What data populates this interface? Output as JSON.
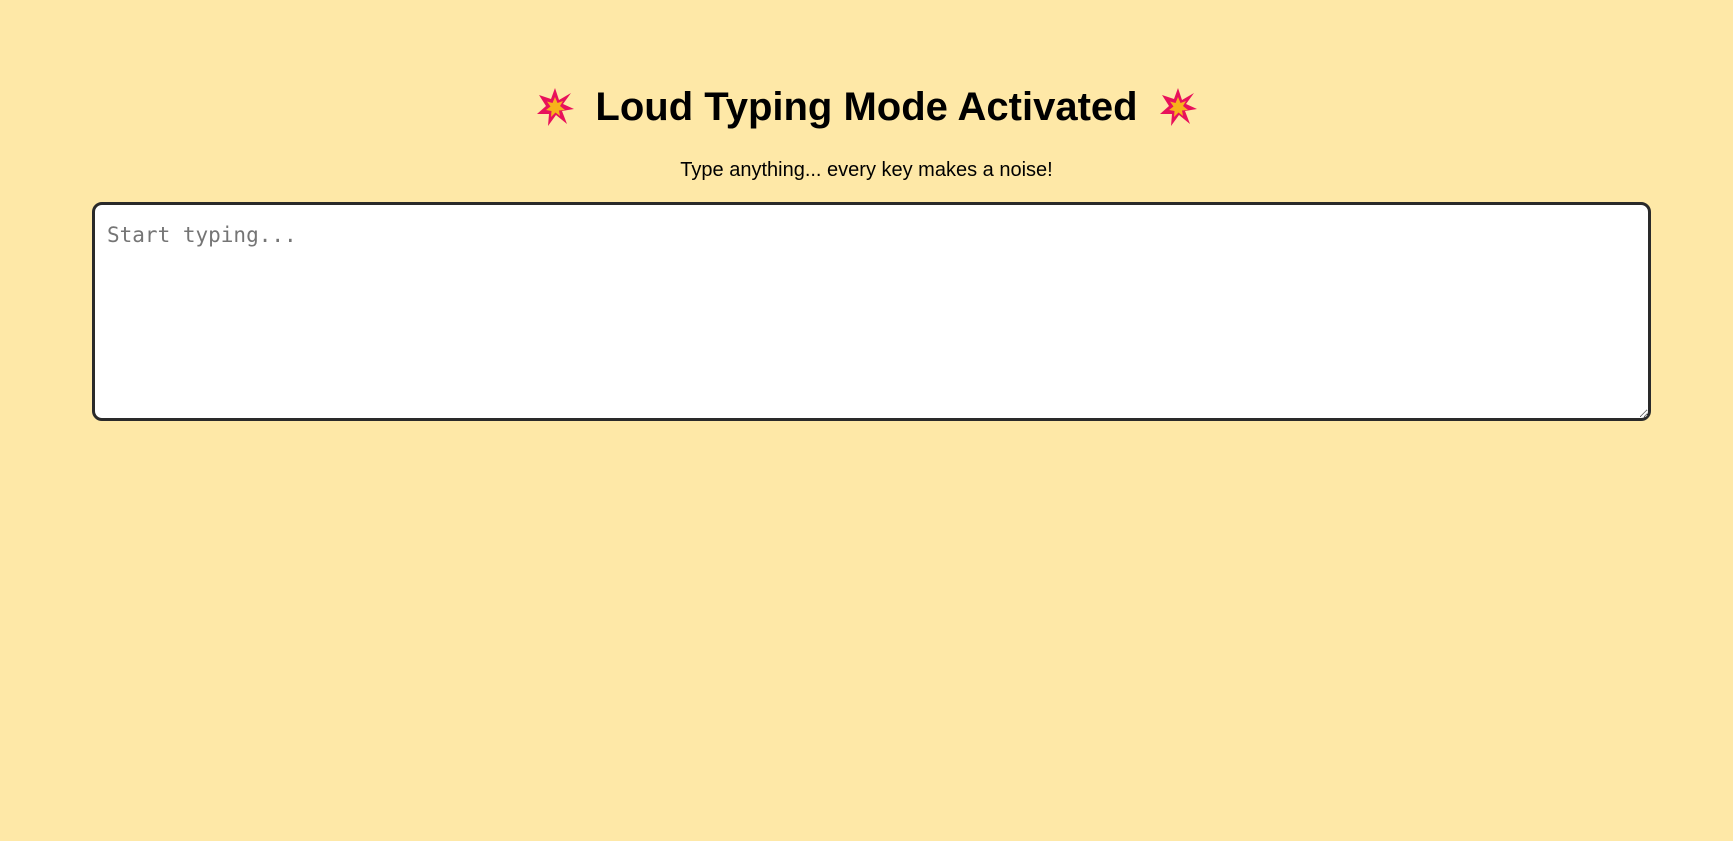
{
  "header": {
    "title": "Loud Typing Mode Activated",
    "left_icon": "collision-burst-icon",
    "right_icon": "collision-burst-icon"
  },
  "subtitle": "Type anything... every key makes a noise!",
  "typing_area": {
    "value": "",
    "placeholder": "Start typing..."
  },
  "colors": {
    "background": "#fee8a7",
    "text": "#000000",
    "field_border": "#2a2a2a",
    "field_background": "#ffffff",
    "placeholder": "#757575",
    "burst_outer": "#e8115b",
    "burst_inner": "#f7b21b"
  }
}
